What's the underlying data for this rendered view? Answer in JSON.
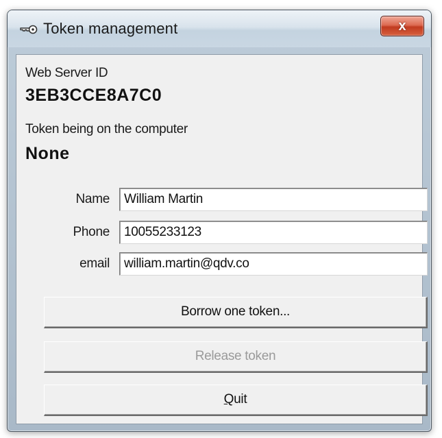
{
  "window": {
    "title": "Token management",
    "close_glyph": "x",
    "icon": "key-icon"
  },
  "server": {
    "label": "Web Server ID",
    "value": "3EB3CCE8A7C0"
  },
  "token": {
    "label": "Token being on the computer",
    "value": "None"
  },
  "form": {
    "name_label": "Name",
    "name_value": "William Martin",
    "phone_label": "Phone",
    "phone_value": "10055233123",
    "email_label": "email",
    "email_value": "william.martin@qdv.co"
  },
  "buttons": {
    "borrow_label": "Borrow one token...",
    "release_label": "Release token",
    "quit_mnemonic": "Q",
    "quit_rest": "uit"
  },
  "colors": {
    "close_button": "#c13b20",
    "disabled_text": "#9a9a9a",
    "client_bg": "#f0f0f0"
  }
}
